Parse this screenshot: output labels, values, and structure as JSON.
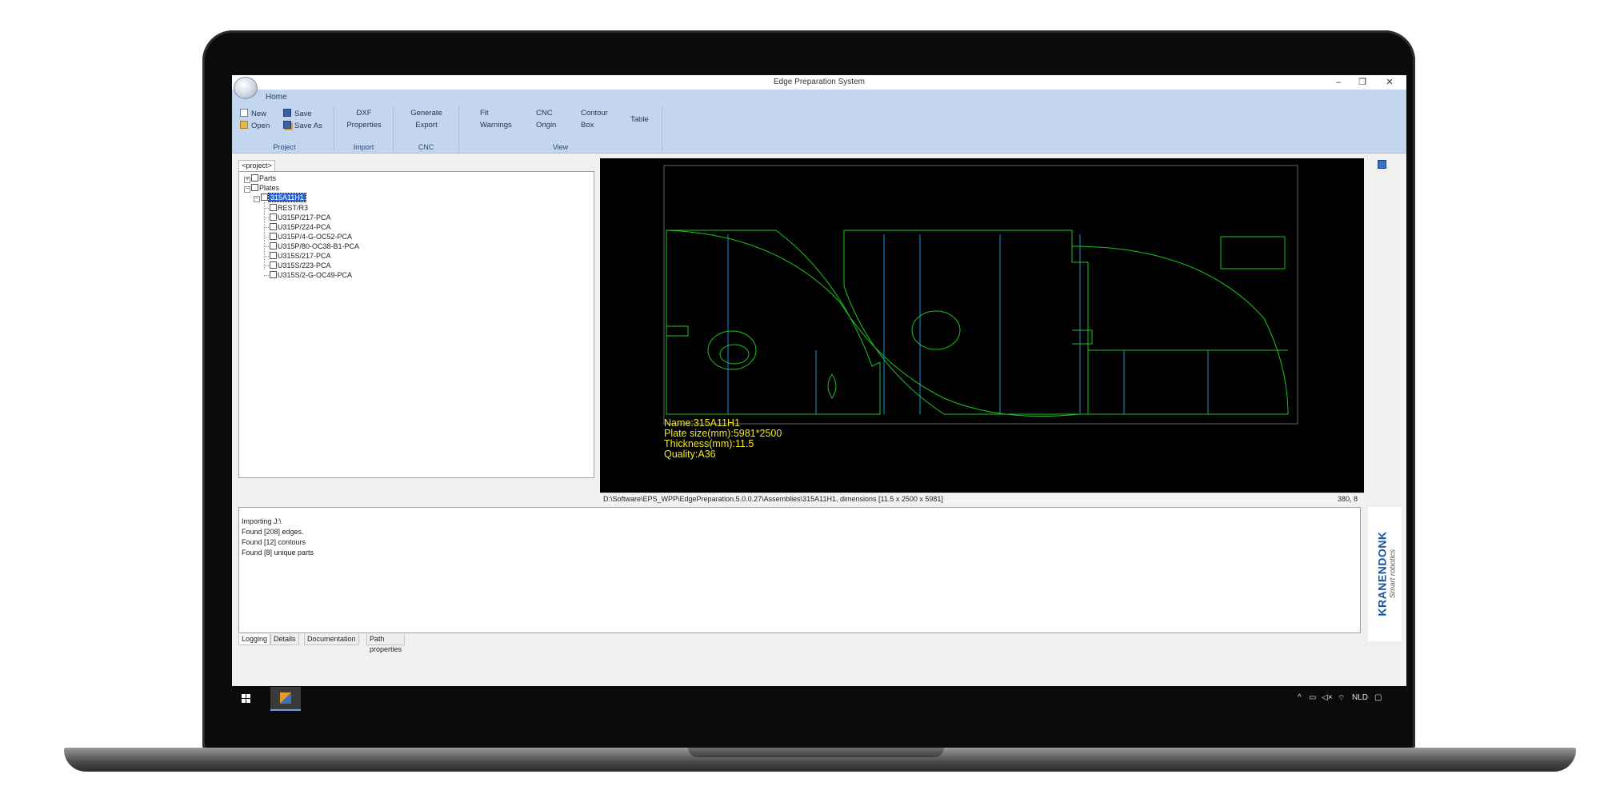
{
  "window": {
    "title": "Edge Preparation System",
    "controls": {
      "minimize": "–",
      "maximize": "❐",
      "close": "✕"
    }
  },
  "ribbon": {
    "tab": "Home",
    "groups": {
      "project": {
        "label": "Project",
        "new": "New",
        "open": "Open",
        "save": "Save",
        "save_as": "Save As"
      },
      "import": {
        "label": "Import",
        "dxf": "DXF",
        "properties": "Properties"
      },
      "cnc": {
        "label": "CNC",
        "generate": "Generate",
        "export": "Export"
      },
      "view": {
        "label": "View",
        "fit": "Fit",
        "warnings": "Warnings",
        "cnc": "CNC",
        "origin": "Origin",
        "contour": "Contour",
        "box": "Box",
        "table": "Table"
      }
    }
  },
  "tree": {
    "tab": "<project>",
    "parts": "Parts",
    "plates": "Plates",
    "plate": "315A11H1",
    "items": [
      "REST/R3",
      "U315P/217-PCA",
      "U315P/224-PCA",
      "U315P/4-G-OC52-PCA",
      "U315P/80-OC38-B1-PCA",
      "U315S/217-PCA",
      "U315S/223-PCA",
      "U315S/2-G-OC49-PCA"
    ]
  },
  "viewer": {
    "plate_info": {
      "name": "Name:315A11H1",
      "size": "Plate size(mm):5981*2500",
      "thickness": "Thickness(mm):11.5",
      "quality": "Quality:A36"
    },
    "colors": {
      "background": "#000000",
      "outline": "#1ec41e",
      "cut_line": "#1f8fd8",
      "text": "#f2ea1b"
    }
  },
  "status": {
    "path": "D:\\Software\\EPS_WPP\\EdgePreparation.5.0.0.27\\Assemblies\\315A11H1,     dimensions [11.5 x 2500 x 5981]",
    "coords": "380, 8"
  },
  "log": {
    "lines": [
      "Importing J:\\",
      "Found [208] edges.",
      "Found [12] contours",
      "Found [8] unique parts"
    ],
    "tabs": [
      "Logging",
      "Details",
      "Documentation",
      "Path properties"
    ]
  },
  "brand": {
    "name": "KRANENDONK",
    "tagline": "Smart robotics"
  },
  "taskbar": {
    "language": "NLD",
    "tray_icons": [
      "chevron-up-icon",
      "network-icon",
      "volume-icon",
      "wifi-icon"
    ]
  }
}
